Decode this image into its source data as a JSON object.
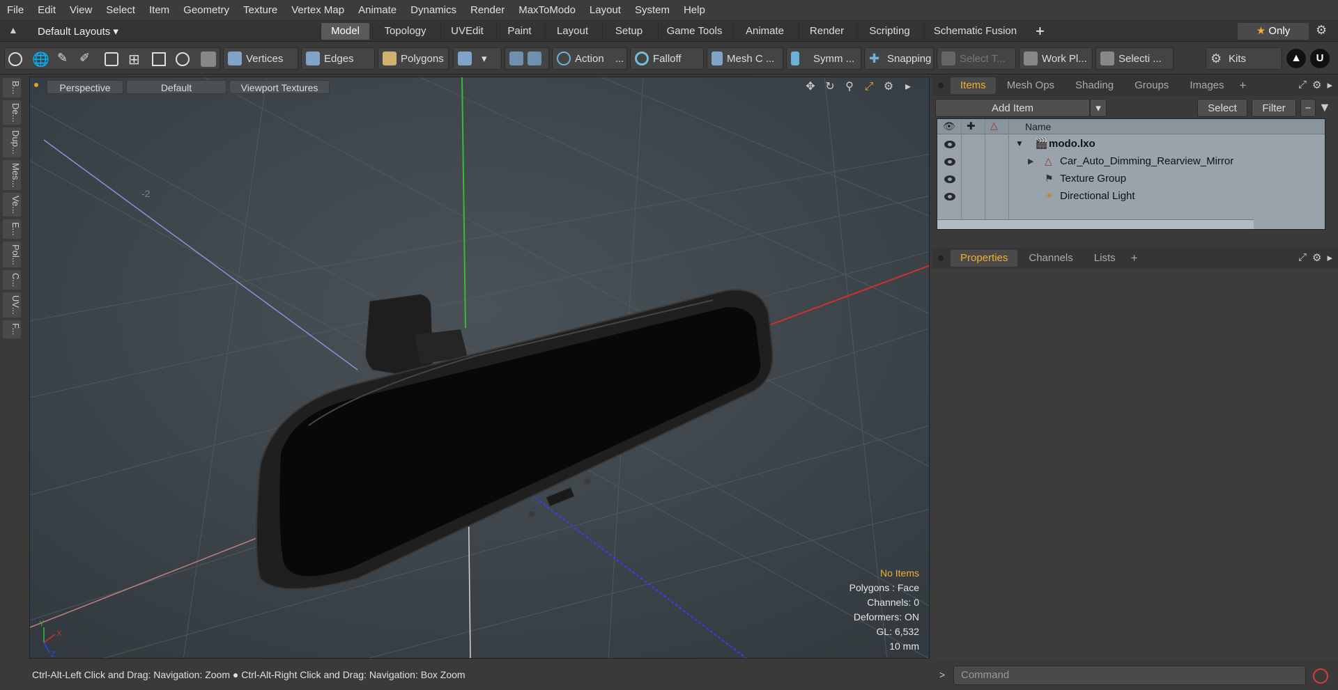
{
  "menu": [
    "File",
    "Edit",
    "View",
    "Select",
    "Item",
    "Geometry",
    "Texture",
    "Vertex Map",
    "Animate",
    "Dynamics",
    "Render",
    "MaxToModo",
    "Layout",
    "System",
    "Help"
  ],
  "layout_selector": "Default Layouts",
  "mode_tabs": [
    "Model",
    "Topology",
    "UVEdit",
    "Paint",
    "Layout",
    "Setup",
    "Game Tools",
    "Animate",
    "Render",
    "Scripting",
    "Schematic Fusion"
  ],
  "active_mode_tab": "Model",
  "only_label": "Only",
  "toolbar": {
    "vertices": "Vertices",
    "edges": "Edges",
    "polygons": "Polygons",
    "action": "Action",
    "action_more": "...",
    "falloff": "Falloff",
    "mesh_c": "Mesh C ...",
    "symm": "Symm ...",
    "snapping": "Snapping",
    "select_t": "Select T...",
    "work_pl": "Work Pl...",
    "selecti": "Selecti ...",
    "kits": "Kits"
  },
  "left_tabs": [
    "B...",
    "De...",
    "Dup...",
    "Mes...",
    "Ve...",
    "E...",
    "Pol...",
    "C...",
    "UV...",
    "F..."
  ],
  "viewport": {
    "view": "Perspective",
    "shading": "Default",
    "textures": "Viewport Textures",
    "axis_label": "-2"
  },
  "stats": {
    "no_items": "No Items",
    "polygons": "Polygons : Face",
    "channels": "Channels: 0",
    "deformers": "Deformers: ON",
    "gl": "GL: 6,532",
    "unit": "10 mm"
  },
  "status_text": "Ctrl-Alt-Left Click and Drag: Navigation: Zoom ● Ctrl-Alt-Right Click and Drag: Navigation: Box Zoom",
  "items_panel": {
    "tabs": [
      "Items",
      "Mesh Ops",
      "Shading",
      "Groups",
      "Images"
    ],
    "active_tab": "Items",
    "add_item": "Add Item",
    "select": "Select",
    "filter": "Filter",
    "name_header": "Name",
    "tree": [
      {
        "label": "modo.lxo",
        "bold": true
      },
      {
        "label": "Car_Auto_Dimming_Rearview_Mirror"
      },
      {
        "label": "Texture Group"
      },
      {
        "label": "Directional Light"
      }
    ]
  },
  "props_panel": {
    "tabs": [
      "Properties",
      "Channels",
      "Lists"
    ],
    "active_tab": "Properties"
  },
  "command_placeholder": "Command",
  "colors": {
    "accent": "#f0b030",
    "axis_x": "#d03030",
    "axis_y": "#30c030",
    "axis_z": "#3040ff"
  }
}
